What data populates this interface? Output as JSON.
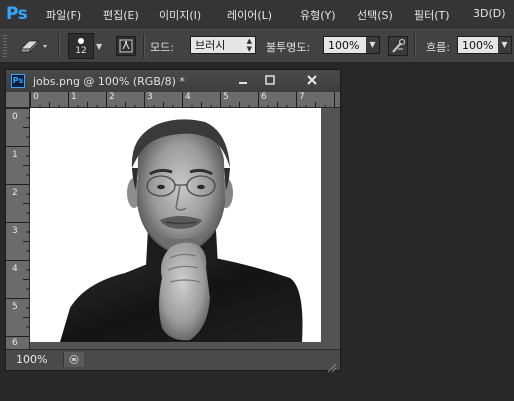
{
  "app": {
    "logo": "Ps"
  },
  "menu": [
    "파일(F)",
    "편집(E)",
    "이미지(I)",
    "레이어(L)",
    "유형(Y)",
    "선택(S)",
    "필터(T)",
    "3D(D)"
  ],
  "options": {
    "brush_size": "12",
    "mode_label": "모드:",
    "mode_value": "브러시",
    "opacity_label": "불투명도:",
    "opacity_value": "100%",
    "flow_label": "흐름:",
    "flow_value": "100%"
  },
  "document": {
    "title": "jobs.png @ 100% (RGB/8) *",
    "zoom": "100%",
    "ruler_top": [
      "0",
      "1",
      "2",
      "3",
      "4",
      "5",
      "6",
      "7"
    ],
    "ruler_left": [
      "0",
      "1",
      "2",
      "3",
      "4",
      "5",
      "6"
    ]
  },
  "icons": {
    "eraser": "eraser-icon",
    "brush_preview": "brush-preset-icon",
    "brush_panel": "brush-panel-icon",
    "airbrush": "airbrush-icon"
  },
  "colors": {
    "accent": "#31a8ff",
    "menubar": "#353535",
    "optionsbar": "#424242",
    "workspace": "#282828"
  }
}
